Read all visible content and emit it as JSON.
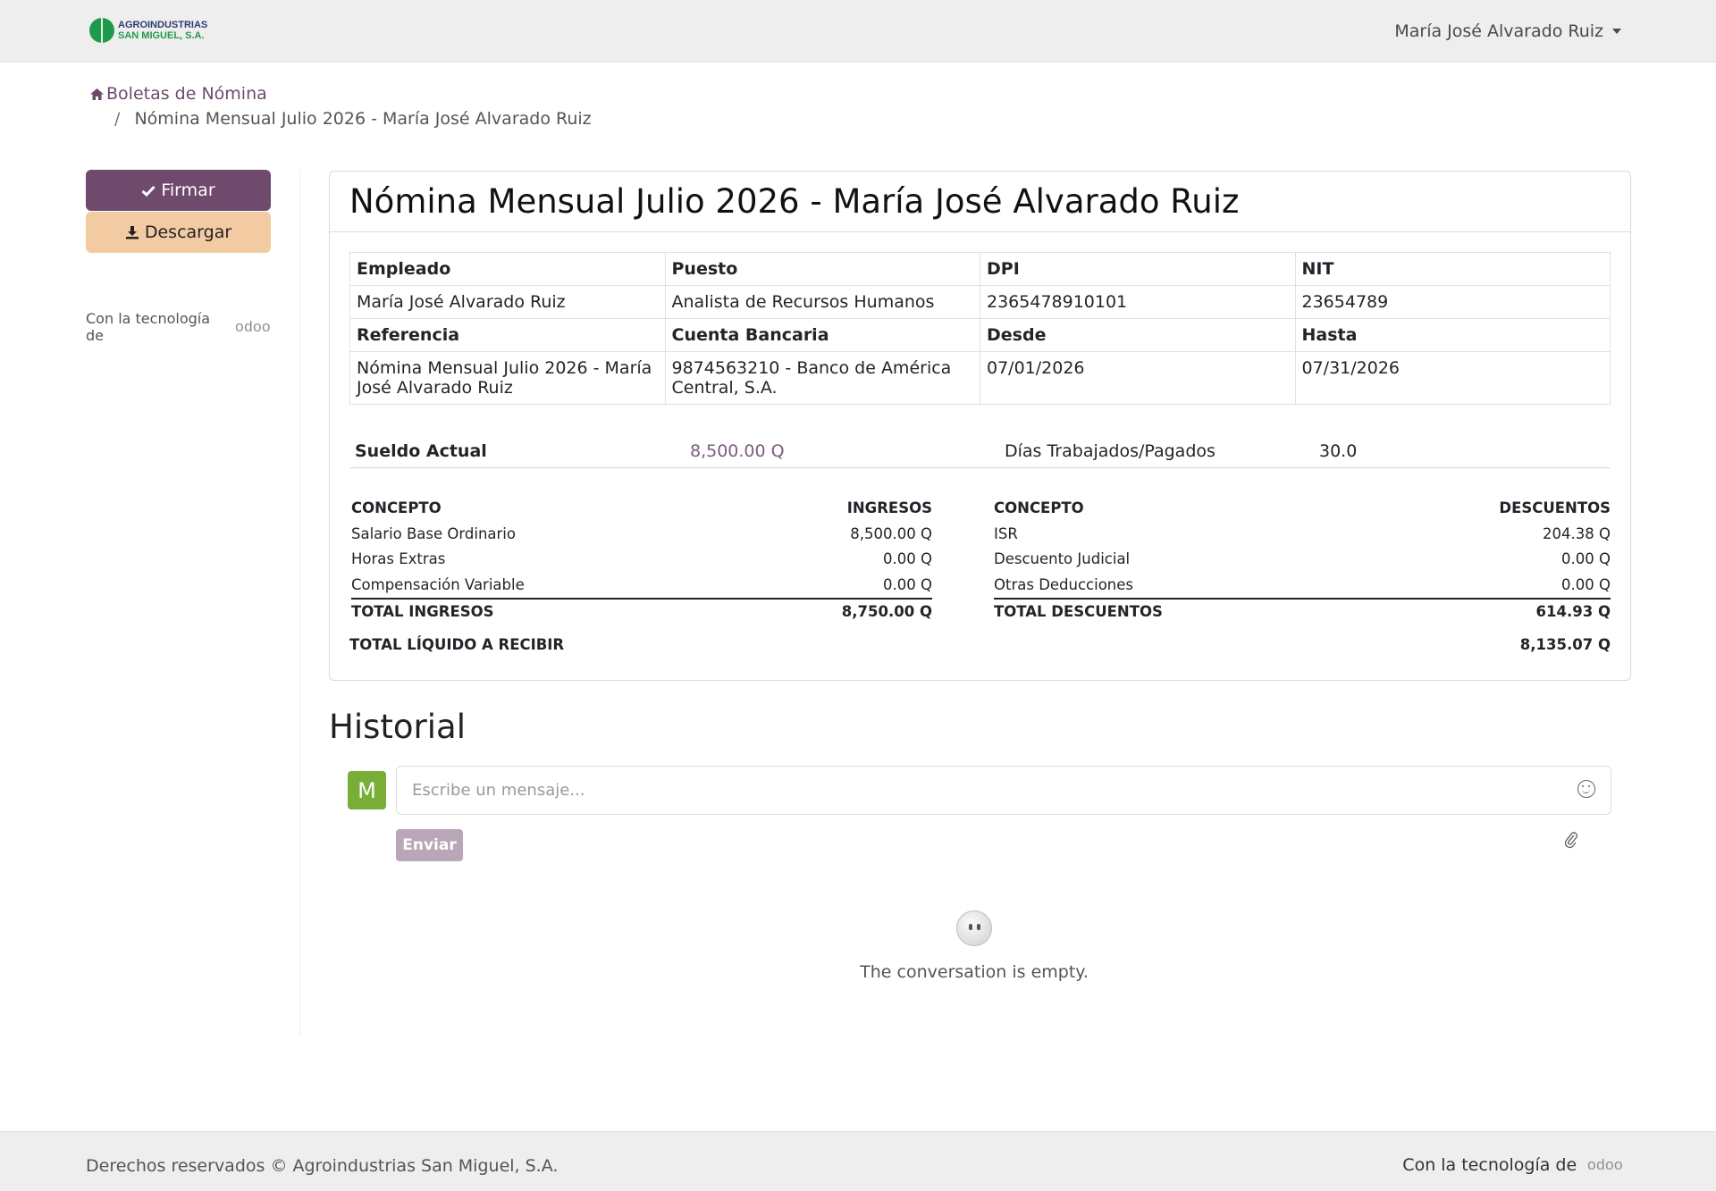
{
  "brand": {
    "line1": "AGROINDUSTRIAS",
    "line2": "SAN MIGUEL, S.A."
  },
  "user": {
    "name": "María José Alvarado Ruiz"
  },
  "breadcrumb": {
    "home_label": "Boletas de Nómina",
    "separator": "/",
    "current": "Nómina Mensual Julio 2026 - María José Alvarado Ruiz"
  },
  "sidebar": {
    "sign_label": "Firmar",
    "download_label": "Descargar",
    "powered_by": "Con la tecnología de",
    "powered_logo": "odoo"
  },
  "payslip": {
    "title": "Nómina Mensual Julio 2026 - María José Alvarado Ruiz",
    "info": {
      "headers_top": [
        "Empleado",
        "Puesto",
        "DPI",
        "NIT"
      ],
      "values_top": [
        "María José Alvarado Ruiz",
        "Analista de Recursos Humanos",
        "2365478910101",
        "23654789"
      ],
      "headers_bottom": [
        "Referencia",
        "Cuenta Bancaria",
        "Desde",
        "Hasta"
      ],
      "values_bottom": [
        "Nómina Mensual Julio 2026 - María José Alvarado Ruiz",
        "9874563210 - Banco de América Central, S.A.",
        "07/01/2026",
        "07/31/2026"
      ]
    },
    "salary": {
      "label": "Sueldo Actual",
      "value": "8,500.00 Q",
      "days_label": "Días Trabajados/Pagados",
      "days_value": "30.0"
    },
    "income": {
      "header_concept": "CONCEPTO",
      "header_amount": "INGRESOS",
      "rows": [
        {
          "concept": "Salario Base Ordinario",
          "amount": "8,500.00 Q"
        },
        {
          "concept": "Horas Extras",
          "amount": "0.00 Q"
        },
        {
          "concept": "Compensación Variable",
          "amount": "0.00 Q"
        }
      ],
      "total_label": "TOTAL INGRESOS",
      "total_value": "8,750.00 Q"
    },
    "deductions": {
      "header_concept": "CONCEPTO",
      "header_amount": "DESCUENTOS",
      "rows": [
        {
          "concept": "ISR",
          "amount": "204.38 Q"
        },
        {
          "concept": "Descuento Judicial",
          "amount": "0.00 Q"
        },
        {
          "concept": "Otras Deducciones",
          "amount": "0.00 Q"
        }
      ],
      "total_label": "TOTAL DESCUENTOS",
      "total_value": "614.93 Q"
    },
    "net": {
      "label": "TOTAL LÍQUIDO A RECIBIR",
      "value": "8,135.07 Q"
    }
  },
  "history": {
    "title": "Historial",
    "avatar_letter": "M",
    "input_placeholder": "Escribe un mensaje...",
    "send_label": "Enviar",
    "empty_text": "The conversation is empty."
  },
  "footer": {
    "copyright": "Derechos reservados © Agroindustrias San Miguel, S.A.",
    "powered_by": "Con la tecnología de",
    "powered_logo": "odoo"
  },
  "colors": {
    "primary": "#6f4a6d",
    "secondary": "#f2cba3",
    "avatar": "#78ad37",
    "link": "#6d4a6c"
  }
}
